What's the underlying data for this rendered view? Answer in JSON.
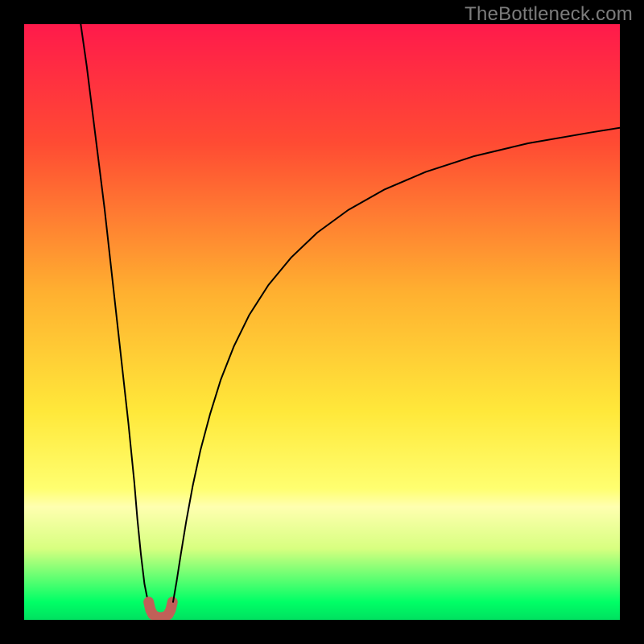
{
  "watermark": "TheBottleneck.com",
  "chart_data": {
    "type": "line",
    "title": "",
    "xlabel": "",
    "ylabel": "",
    "xlim": [
      0,
      100
    ],
    "ylim": [
      0,
      100
    ],
    "grid": false,
    "background_gradient": {
      "stops": [
        {
          "offset": 0,
          "color": "#ff1a4b"
        },
        {
          "offset": 20,
          "color": "#ff4b33"
        },
        {
          "offset": 45,
          "color": "#ffb030"
        },
        {
          "offset": 65,
          "color": "#ffe83a"
        },
        {
          "offset": 78,
          "color": "#ffff70"
        },
        {
          "offset": 81,
          "color": "#ffffb0"
        },
        {
          "offset": 88,
          "color": "#d8ff80"
        },
        {
          "offset": 97,
          "color": "#00ff66"
        },
        {
          "offset": 100,
          "color": "#00e060"
        }
      ]
    },
    "series": [
      {
        "name": "curve-left",
        "stroke": "#000000",
        "stroke_width": 2,
        "x": [
          9.5,
          10.5,
          11.5,
          12.5,
          13.5,
          14.5,
          15.5,
          16.5,
          17.5,
          18.5,
          19.0,
          19.6,
          20.2,
          20.8
        ],
        "y": [
          100,
          93,
          85,
          77,
          69,
          60,
          51,
          42,
          33,
          23,
          17,
          11,
          6,
          3
        ]
      },
      {
        "name": "valley-marker",
        "stroke": "#c06058",
        "stroke_width": 13,
        "x": [
          20.9,
          21.2,
          21.6,
          22.2,
          22.9,
          23.6,
          24.2,
          24.6,
          24.9
        ],
        "y": [
          3.0,
          1.7,
          0.9,
          0.5,
          0.4,
          0.5,
          0.9,
          1.7,
          3.0
        ]
      },
      {
        "name": "curve-right",
        "stroke": "#000000",
        "stroke_width": 2,
        "x": [
          25.0,
          25.6,
          26.3,
          27.2,
          28.3,
          29.6,
          31.2,
          33.0,
          35.2,
          37.8,
          41.0,
          44.8,
          49.2,
          54.4,
          60.4,
          67.4,
          75.4,
          84.6,
          95.0,
          100.0
        ],
        "y": [
          3.0,
          6.5,
          11.0,
          16.5,
          22.5,
          28.5,
          34.5,
          40.3,
          45.9,
          51.2,
          56.2,
          60.8,
          65.0,
          68.8,
          72.2,
          75.2,
          77.8,
          80.0,
          81.8,
          82.6
        ]
      }
    ]
  }
}
